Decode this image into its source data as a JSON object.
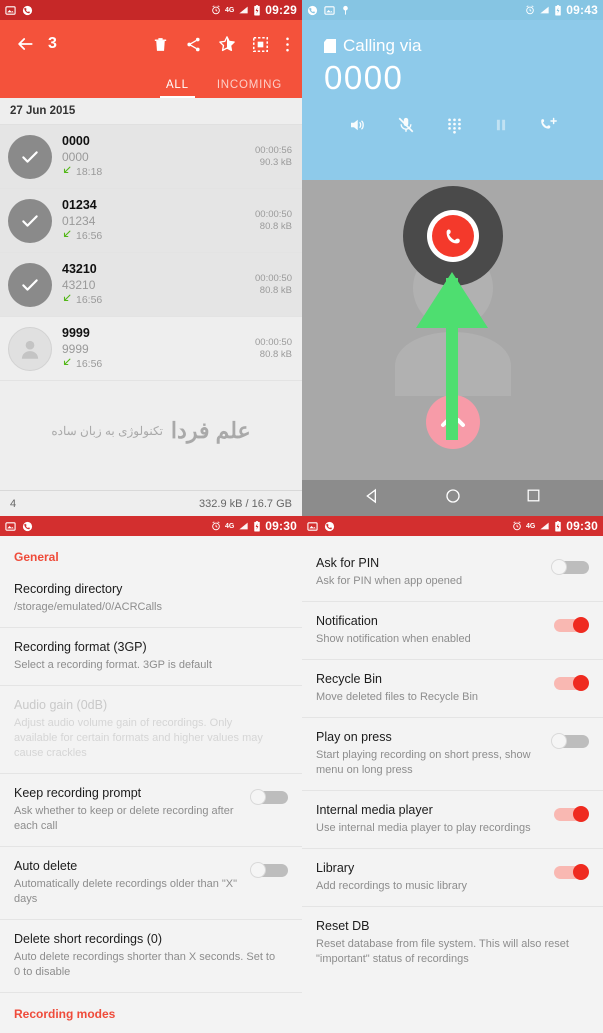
{
  "panel_call_log": {
    "status_bar": {
      "time": "09:29",
      "network": "4G",
      "icons": [
        "screenshot-icon",
        "call-recorder-icon",
        "alarm-icon",
        "network-4g-icon",
        "signal-icon",
        "battery-charging-icon"
      ]
    },
    "toolbar": {
      "back_label": "←",
      "selected_count": "3",
      "actions": [
        "delete-icon",
        "share-icon",
        "star-half-icon",
        "select-all-icon",
        "overflow-menu-icon"
      ]
    },
    "tabs": [
      {
        "label": "ALL",
        "active": true
      },
      {
        "label": "INCOMING",
        "active": false
      }
    ],
    "date_header": "27 Jun 2015",
    "calls": [
      {
        "name": "0000",
        "number": "0000",
        "time": "18:18",
        "duration": "00:00:56",
        "size": "90.3 kB",
        "selected": true,
        "direction": "incoming"
      },
      {
        "name": "01234",
        "number": "01234",
        "time": "16:56",
        "duration": "00:00:50",
        "size": "80.8 kB",
        "selected": true,
        "direction": "incoming"
      },
      {
        "name": "43210",
        "number": "43210",
        "time": "16:56",
        "duration": "00:00:50",
        "size": "80.8 kB",
        "selected": true,
        "direction": "incoming"
      },
      {
        "name": "9999",
        "number": "9999",
        "time": "16:56",
        "duration": "00:00:50",
        "size": "80.8 kB",
        "selected": false,
        "direction": "incoming"
      }
    ],
    "watermark": {
      "main": "علم فردا",
      "sub": "تکنولوژی به زبان ساده"
    },
    "footer": {
      "count": "4",
      "storage": "332.9 kB / 16.7 GB"
    }
  },
  "panel_in_call": {
    "status_bar": {
      "time": "09:43",
      "icons": [
        "call-icon",
        "screenshot-icon",
        "location-icon",
        "alarm-icon",
        "signal-icon",
        "battery-charging-icon"
      ]
    },
    "calling_via_label": "Calling via",
    "number": "0000",
    "actions": [
      "speaker-icon",
      "mute-mic-icon",
      "dialpad-icon",
      "pause-icon",
      "add-call-icon"
    ],
    "decline_button": "decline-call-icon",
    "swipe_button": "swipe-up-icon",
    "nav_bar": [
      "back-nav-icon",
      "home-nav-icon",
      "recents-nav-icon"
    ]
  },
  "panel_settings_general": {
    "status_bar": {
      "time": "09:30",
      "network": "4G"
    },
    "section_title": "General",
    "items": [
      {
        "title": "Recording directory",
        "sub": "/storage/emulated/0/ACRCalls",
        "toggle": null,
        "disabled": false
      },
      {
        "title": "Recording format (3GP)",
        "sub": "Select a recording format. 3GP is default",
        "toggle": null,
        "disabled": false
      },
      {
        "title": "Audio gain (0dB)",
        "sub": "Adjust audio volume gain of recordings. Only available for certain formats and higher values may cause crackles",
        "toggle": null,
        "disabled": true
      },
      {
        "title": "Keep recording prompt",
        "sub": "Ask whether to keep or delete recording after each call",
        "toggle": "off",
        "disabled": false
      },
      {
        "title": "Auto delete",
        "sub": "Automatically delete recordings older than \"X\" days",
        "toggle": "off",
        "disabled": false
      },
      {
        "title": "Delete short recordings (0)",
        "sub": "Auto delete recordings shorter than X seconds. Set to 0 to disable",
        "toggle": null,
        "disabled": false
      }
    ],
    "footer_link": "Recording modes"
  },
  "panel_settings_other": {
    "status_bar": {
      "time": "09:30",
      "network": "4G"
    },
    "items": [
      {
        "title": "Ask for PIN",
        "sub": "Ask for PIN when app opened",
        "toggle": "off"
      },
      {
        "title": "Notification",
        "sub": "Show notification when enabled",
        "toggle": "on"
      },
      {
        "title": "Recycle Bin",
        "sub": "Move deleted files to Recycle Bin",
        "toggle": "on"
      },
      {
        "title": "Play on press",
        "sub": "Start playing recording on short press, show menu on long press",
        "toggle": "off"
      },
      {
        "title": "Internal media player",
        "sub": "Use internal media player to play recordings",
        "toggle": "on"
      },
      {
        "title": "Library",
        "sub": "Add recordings to music library",
        "toggle": "on"
      },
      {
        "title": "Reset DB",
        "sub": "Reset database from file system. This will also reset \"important\" status of recordings",
        "toggle": null
      }
    ]
  },
  "colors": {
    "toolbar_red": "#f4523b",
    "status_red": "#c62828",
    "settings_status_red": "#d32f2f",
    "accent_red": "#ef4b3a",
    "call_blue": "#8ecaea",
    "call_body_gray": "#a8a8a8",
    "arrow_green": "#4ede70",
    "swipe_pink": "#f79ba8"
  }
}
